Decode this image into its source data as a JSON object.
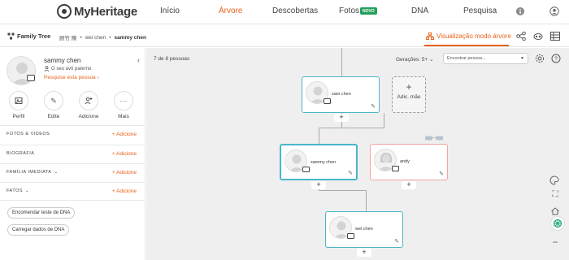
{
  "brand": "MyHeritage",
  "nav": {
    "items": [
      {
        "label": "Início",
        "active": false
      },
      {
        "label": "Árvore",
        "active": true
      },
      {
        "label": "Descobertas",
        "active": false
      },
      {
        "label": "Fotos",
        "active": false
      },
      {
        "label": "DNA",
        "active": false
      },
      {
        "label": "Pesquisa",
        "active": false
      }
    ],
    "fotos_badge": "NOVO"
  },
  "subbar": {
    "title": "Family Tree",
    "breadcrumbs": [
      "顾竹 陳",
      "wei chen",
      "sammy chen"
    ],
    "view_mode": "Visualização modo árvore"
  },
  "profile": {
    "name": "sammy chen",
    "relation": "O seu avô paterno",
    "search_link": "Pesquise esta pessoa ›",
    "actions": [
      {
        "label": "Perfil",
        "icon": "profile-icon"
      },
      {
        "label": "Edite",
        "icon": "pencil-icon"
      },
      {
        "label": "Adicione",
        "icon": "add-person-icon"
      },
      {
        "label": "Mais",
        "icon": "more-icon"
      }
    ],
    "sections": [
      {
        "title": "FOTOS & VIDEOS",
        "add": "+ Adicione"
      },
      {
        "title": "BIOGRAFIA",
        "add": "+ Adicione"
      },
      {
        "title": "FAMÍLIA IMEDIATA",
        "add": "+ Adicione"
      },
      {
        "title": "FATOS",
        "add": "+ Adicione"
      }
    ],
    "buttons": [
      "Encomendar teste de DNA",
      "Carregar dados de DNA"
    ]
  },
  "canvas": {
    "count": "7 de 8 pessoas",
    "generations": "Gerações: 5+ ⌄",
    "find_placeholder": "Encontrar pessoa...",
    "cards": [
      {
        "name": "sam chen",
        "gender": "male"
      },
      {
        "name": "sammy chen",
        "gender": "male"
      },
      {
        "name": "andy",
        "gender": "female"
      },
      {
        "name": "wei chen",
        "gender": "male"
      }
    ],
    "add_mother": "Adic. mãe"
  },
  "colors": {
    "accent": "#e8621a",
    "male": "#4ab7c9",
    "female": "#f3a3a0",
    "badge": "#22a05b"
  }
}
